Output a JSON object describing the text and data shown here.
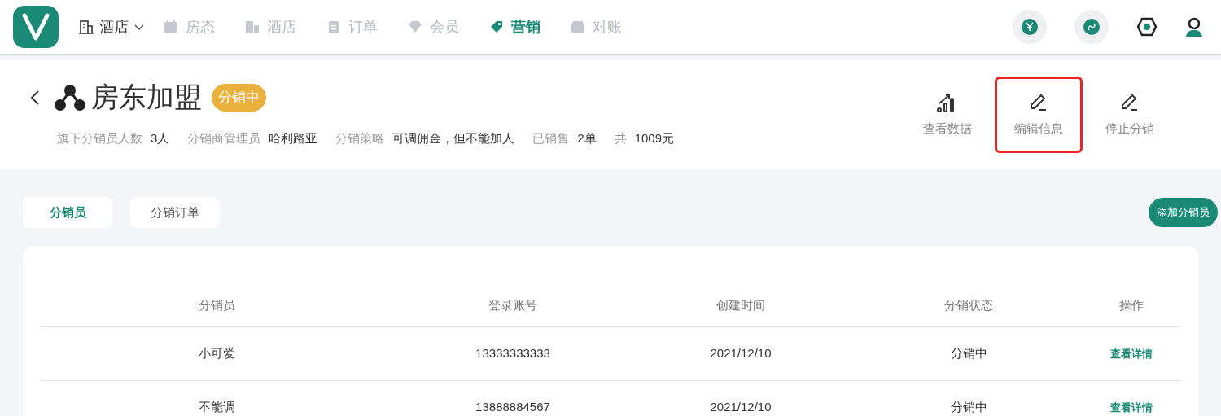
{
  "nav": {
    "hotel_switch": {
      "label": "酒店",
      "expanded": false
    },
    "items": [
      {
        "label": "房态",
        "kind": "calendar",
        "selected": false
      },
      {
        "label": "酒店",
        "kind": "building",
        "selected": false
      },
      {
        "label": "订单",
        "kind": "clipboard",
        "selected": false
      },
      {
        "label": "会员",
        "kind": "diamond",
        "selected": false
      },
      {
        "label": "营销",
        "kind": "tag",
        "selected": true
      },
      {
        "label": "对账",
        "kind": "wallet",
        "selected": false
      }
    ]
  },
  "detail": {
    "title": "房东加盟",
    "status": "分销中",
    "meta": [
      {
        "label": "旗下分销员人数",
        "value": "3人"
      },
      {
        "label": "分销商管理员",
        "value": "哈利路亚"
      },
      {
        "label": "分销策略",
        "value": "可调佣金，但不能加人"
      },
      {
        "label": "已销售",
        "value": "2单"
      },
      {
        "label": "共",
        "value": "1009元"
      }
    ],
    "actions": [
      {
        "label": "查看数据",
        "kind": "chart",
        "highlighted": false
      },
      {
        "label": "编辑信息",
        "kind": "pencil",
        "highlighted": true
      },
      {
        "label": "停止分销",
        "kind": "pencil",
        "highlighted": false
      }
    ]
  },
  "tabs": [
    {
      "label": "分销员",
      "selected": true
    },
    {
      "label": "分销订单",
      "selected": false
    }
  ],
  "add_button": "添加分销员",
  "table": {
    "columns": [
      "分销员",
      "登录账号",
      "创建时间",
      "分销状态",
      "操作"
    ],
    "rows": [
      {
        "cells": [
          "小可爱",
          "13333333333",
          "2021/12/10",
          "分销中"
        ],
        "action": "查看详情"
      },
      {
        "cells": [
          "不能调",
          "13888884567",
          "2021/12/10",
          "分销中"
        ],
        "action": "查看详情"
      }
    ]
  }
}
